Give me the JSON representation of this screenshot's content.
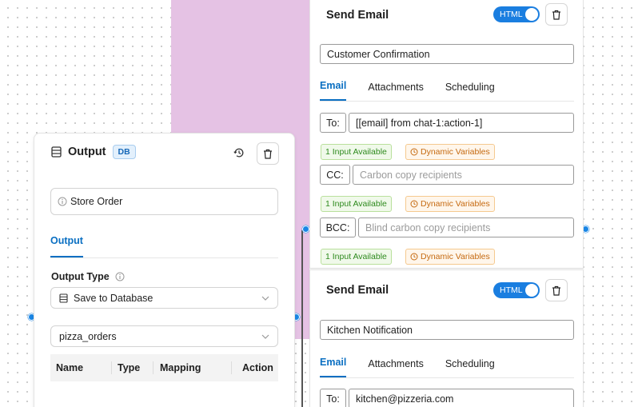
{
  "output_node": {
    "title": "Output",
    "badge": "DB",
    "name_field": "Store Order",
    "tab": "Output",
    "output_type_label": "Output Type",
    "output_type_value": "Save to Database",
    "table_value": "pizza_orders",
    "columns": [
      "Name",
      "Type",
      "Mapping",
      "Action"
    ]
  },
  "email_node_1": {
    "title": "Send Email",
    "toggle_label": "HTML",
    "name_field": "Customer Confirmation",
    "tabs": [
      "Email",
      "Attachments",
      "Scheduling"
    ],
    "to_label": "To:",
    "to_value": "[[email] from chat-1:action-1]",
    "inputs_available": "1 Input Available",
    "dynamic_variables": "Dynamic Variables",
    "cc_label": "CC:",
    "cc_placeholder": "Carbon copy recipients",
    "bcc_label": "BCC:",
    "bcc_placeholder": "Blind carbon copy recipients"
  },
  "email_node_2": {
    "title": "Send Email",
    "toggle_label": "HTML",
    "name_field": "Kitchen Notification",
    "tabs": [
      "Email",
      "Attachments",
      "Scheduling"
    ],
    "to_label": "To:",
    "to_value": "kitchen@pizzeria.com"
  },
  "colors": {
    "accent": "#0a6fc2",
    "canvas_group": "#e5c2e4",
    "success": "#2e8a1e",
    "warning": "#c56a11"
  },
  "icons": {
    "output_node": "database-icon",
    "history": "history-icon",
    "delete": "trash-icon",
    "info": "info-circle-icon",
    "select_arrow": "chevron-down-icon",
    "dynamic_variables": "clock-icon"
  }
}
